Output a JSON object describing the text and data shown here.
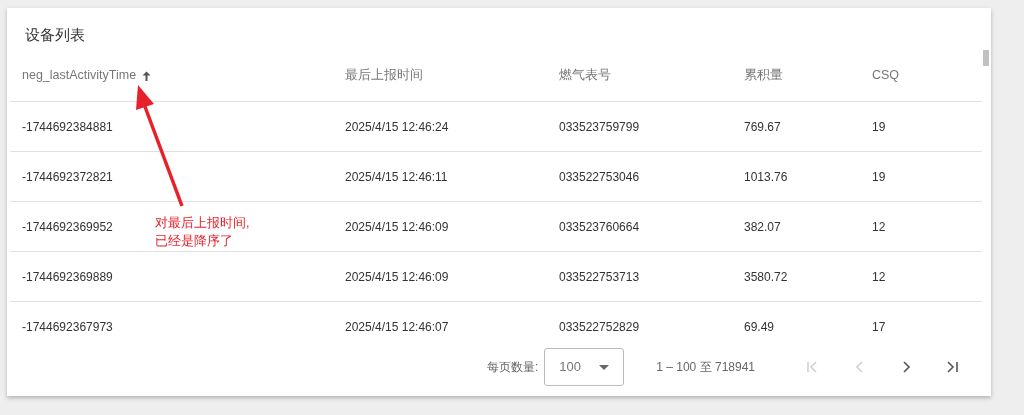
{
  "card": {
    "title": "设备列表"
  },
  "table": {
    "columns": [
      {
        "label": "neg_lastActivityTime",
        "sorted": true
      },
      {
        "label": "最后上报时间",
        "sorted": false
      },
      {
        "label": "燃气表号",
        "sorted": false
      },
      {
        "label": "累积量",
        "sorted": false
      },
      {
        "label": "CSQ",
        "sorted": false
      }
    ],
    "rows": [
      [
        "-1744692384881",
        "2025/4/15 12:46:24",
        "033523759799",
        "769.67",
        "19"
      ],
      [
        "-1744692372821",
        "2025/4/15 12:46:11",
        "033522753046",
        "1013.76",
        "19"
      ],
      [
        "-1744692369952",
        "2025/4/15 12:46:09",
        "033523760664",
        "382.07",
        "12"
      ],
      [
        "-1744692369889",
        "2025/4/15 12:46:09",
        "033522753713",
        "3580.72",
        "12"
      ],
      [
        "-1744692367973",
        "2025/4/15 12:46:07",
        "033522752829",
        "69.49",
        "17"
      ]
    ]
  },
  "paginator": {
    "page_size_label": "每页数量:",
    "page_size": "100",
    "range": "1 – 100 至 718941",
    "buttons": [
      {
        "kind": "first",
        "disabled": true
      },
      {
        "kind": "prev",
        "disabled": true
      },
      {
        "kind": "next",
        "disabled": false
      },
      {
        "kind": "last",
        "disabled": false
      }
    ]
  },
  "annotation": {
    "lines": [
      "对最后上报时间,",
      "已经是降序了"
    ]
  }
}
